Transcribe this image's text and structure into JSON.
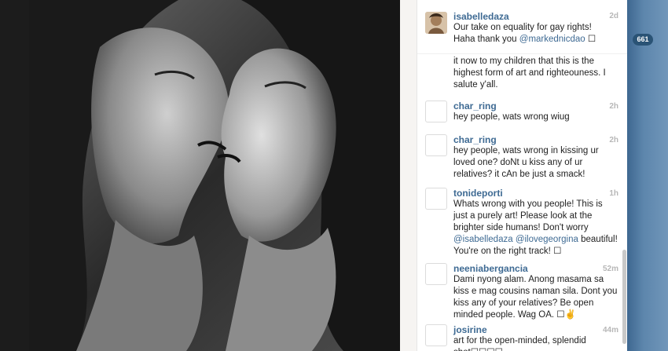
{
  "caption": {
    "username": "isabelledaza",
    "time": "2d",
    "text_line1": "Our take on equality for gay rights!",
    "text_line2_prefix": "Haha thank you ",
    "text_line2_mention": "@markednicdao",
    "text_line2_suffix": " ☐"
  },
  "truncated_comment": {
    "text": "it now to my children that this is the highest form of art and righteouness. I salute y'all."
  },
  "comments": [
    {
      "username": "char_ring",
      "time": "2h",
      "text": "hey people, wats wrong wiug"
    },
    {
      "username": "char_ring",
      "time": "2h",
      "text": "hey people, wats wrong in kissing ur loved one? doNt u kiss any of ur relatives? it cAn be just a smack!"
    },
    {
      "username": "tonideporti",
      "time": "1h",
      "text_before": "Whats wrong with you people! This is just a purely art! Please look at the brighter side humans! Don't worry ",
      "mention1": "@isabelledaza",
      "mention2": "@ilovegeorgina",
      "text_after": "beautiful! You're on the right track! ☐"
    },
    {
      "username": "neeniabergancia",
      "time": "52m",
      "text": "Dami nyong alam. Anong masama sa kiss e mag cousins naman sila. Dont you kiss any of your relatives? Be open minded people. Wag OA. ☐✌"
    },
    {
      "username": "josirine",
      "time": "44m",
      "text": "art for the open-minded, splendid shot☐☐☐☐"
    }
  ],
  "side_badge": "661"
}
